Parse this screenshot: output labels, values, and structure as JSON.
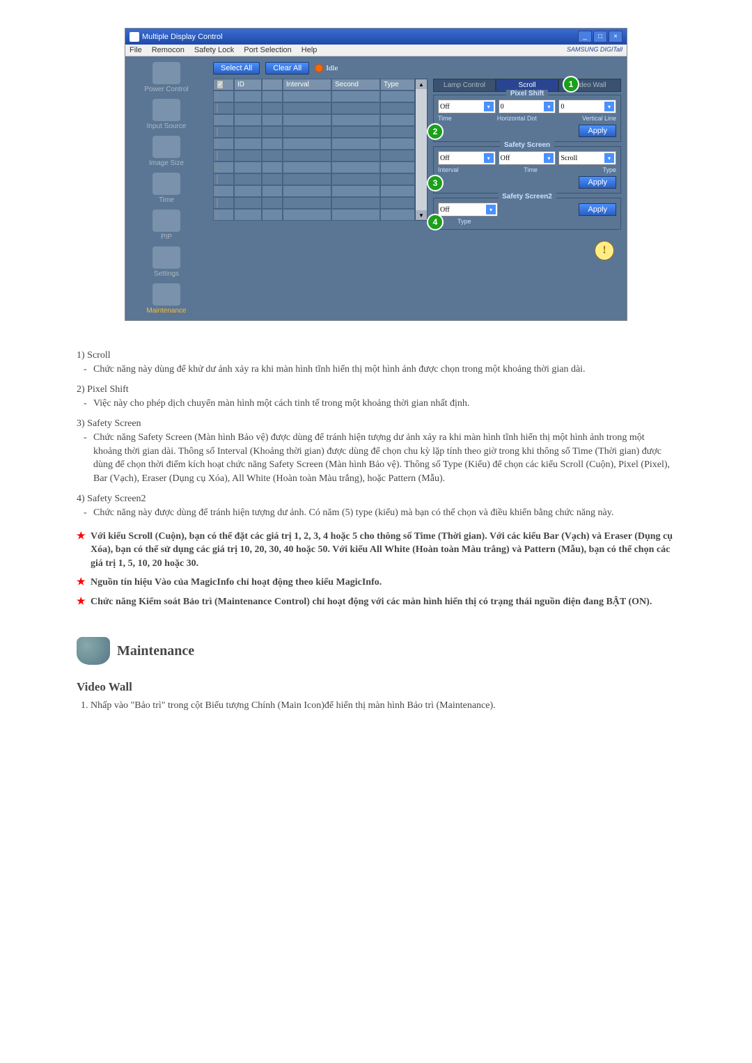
{
  "app": {
    "title": "Multiple Display Control",
    "window_buttons": {
      "minimize": "_",
      "maximize": "□",
      "close": "×"
    },
    "menubar": [
      "File",
      "Remocon",
      "Safety Lock",
      "Port Selection",
      "Help"
    ],
    "brand": "SAMSUNG DIGITall"
  },
  "sidebar": {
    "items": [
      {
        "label": "Power Control",
        "icon": "power-icon"
      },
      {
        "label": "Input Source",
        "icon": "card-icon"
      },
      {
        "label": "Image Size",
        "icon": "display-icon"
      },
      {
        "label": "Time",
        "icon": "lens-icon"
      },
      {
        "label": "PIP",
        "icon": "pip-icon"
      },
      {
        "label": "Settings",
        "icon": "settings-icon"
      },
      {
        "label": "Maintenance",
        "icon": "maintenance-icon"
      }
    ]
  },
  "main": {
    "buttons": {
      "select_all": "Select All",
      "clear_all": "Clear All"
    },
    "idle": "Idle",
    "table_head": [
      "ID",
      "Interval",
      "Second",
      "Type"
    ],
    "rows": 11
  },
  "right": {
    "tabs": [
      "Lamp Control",
      "Scroll",
      "Video Wall"
    ],
    "active_tab": 1,
    "callouts": [
      "1",
      "2",
      "3",
      "4"
    ],
    "pixel_shift": {
      "title": "Pixel Shift",
      "time_value": "Off",
      "hdot_value": "0",
      "vline_value": "0",
      "labels": [
        "Time",
        "Horizontal Dot",
        "Vertical Line"
      ],
      "apply": "Apply"
    },
    "safety_screen": {
      "title": "Safety Screen",
      "interval_value": "Off",
      "time_value": "Off",
      "type_value": "Scroll",
      "labels": [
        "Interval",
        "Time",
        "Type"
      ],
      "apply": "Apply"
    },
    "safety_screen2": {
      "title": "Safety Screen2",
      "type_value": "Off",
      "label": "Type",
      "apply": "Apply"
    }
  },
  "doc": {
    "items": [
      {
        "num": "1)",
        "title": "Scroll",
        "body": "Chức năng này dùng để khử dư ảnh xảy ra khi màn hình tĩnh hiển thị một hình ảnh được chọn trong một khoảng thời gian dài."
      },
      {
        "num": "2)",
        "title": "Pixel Shift",
        "body": "Việc này cho phép dịch chuyển màn hình một cách tinh tế trong một khoảng thời gian nhất định."
      },
      {
        "num": "3)",
        "title": "Safety Screen",
        "body": "Chức năng Safety Screen (Màn hình Bảo vệ) được dùng để tránh hiện tượng dư ảnh xảy ra khi màn hình tĩnh hiển thị một hình ảnh trong một khoảng thời gian dài.  Thông số Interval (Khoảng thời gian) được dùng để chọn chu kỳ lặp tính theo giờ trong khi thông số Time (Thời gian) được dùng để chọn thời điểm kích hoạt chức năng Safety Screen (Màn hình Bảo vệ). Thông số Type (Kiểu) để chọn các kiểu Scroll (Cuộn), Pixel (Pixel), Bar (Vạch), Eraser (Dụng cụ Xóa), All White (Hoàn toàn Màu trắng), hoặc Pattern (Mẫu)."
      },
      {
        "num": "4)",
        "title": "Safety Screen2",
        "body": "Chức năng này được dùng để tránh hiện tượng dư ảnh. Có năm (5) type (kiểu) mà bạn có thể chọn và điều khiển bằng chức năng này."
      }
    ],
    "notes": [
      "Với kiểu Scroll (Cuộn), bạn có thể đặt các giá trị 1, 2, 3, 4 hoặc 5 cho thông số Time (Thời gian). Với các kiểu Bar (Vạch) và Eraser (Dụng cụ Xóa), bạn có thể sử dụng các giá trị 10, 20, 30, 40 hoặc 50. Với kiểu All White (Hoàn toàn Màu trắng) và Pattern (Mẫu), bạn có thể chọn các giá trị 1, 5, 10, 20 hoặc 30.",
      "Nguồn tín hiệu Vào của MagicInfo chỉ hoạt động theo kiểu MagicInfo.",
      "Chức năng Kiểm soát Bảo trì (Maintenance Control) chỉ hoạt động với các màn hình hiển thị có trạng thái nguồn điện đang BẬT (ON)."
    ],
    "section_title": "Maintenance",
    "video_wall_heading": "Video Wall",
    "video_wall_step": "Nhấp vào \"Bảo trì\" trong cột Biểu tượng Chính (Main Icon)để hiển thị màn hình Bảo trì (Maintenance)."
  }
}
